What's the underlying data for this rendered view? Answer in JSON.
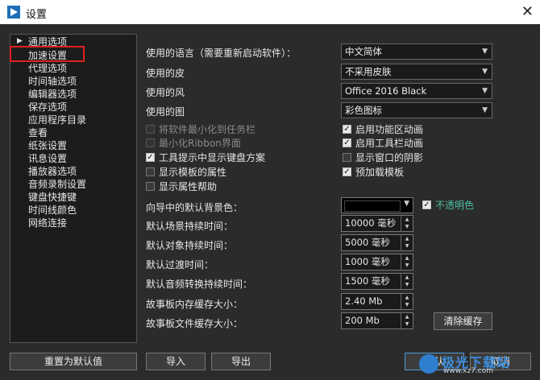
{
  "window": {
    "title": "设置"
  },
  "nav": {
    "items": [
      "通用选项",
      "加速设置",
      "代理选项",
      "时间轴选项",
      "编辑器选项",
      "保存选项",
      "应用程序目录",
      "查看",
      "纸张设置",
      "讯息设置",
      "播放器选项",
      "音频录制设置",
      "键盘快捷键",
      "时间线颜色",
      "网络连接"
    ]
  },
  "settings": {
    "language": {
      "label": "使用的语言（需要重新启动软件）：",
      "value": "中文简体"
    },
    "skin": {
      "label": "使用的皮",
      "value": "不采用皮肤"
    },
    "style": {
      "label": "使用的风",
      "value": "Office 2016 Black"
    },
    "icons": {
      "label": "使用的图",
      "value": "彩色图标"
    }
  },
  "checkboxes": {
    "left": [
      {
        "label": "将软件最小化到任务栏",
        "checked": false,
        "enabled": false
      },
      {
        "label": "最小化Ribbon界面",
        "checked": false,
        "enabled": false
      },
      {
        "label": "工具提示中显示键盘方案",
        "checked": true,
        "enabled": true
      },
      {
        "label": "显示模板的属性",
        "checked": false,
        "enabled": true
      },
      {
        "label": "显示属性帮助",
        "checked": false,
        "enabled": true
      }
    ],
    "right": [
      {
        "label": "启用功能区动画",
        "checked": true,
        "enabled": true
      },
      {
        "label": "启用工具栏动画",
        "checked": true,
        "enabled": true
      },
      {
        "label": "显示窗口的阴影",
        "checked": false,
        "enabled": true
      },
      {
        "label": "预加载模板",
        "checked": true,
        "enabled": true
      }
    ]
  },
  "wizard": {
    "bg_label": "向导中的默认背景色：",
    "bg_color": "#000000",
    "opaque_label": "不透明色",
    "opaque_checked": true
  },
  "durations": [
    {
      "label": "默认场景持续时间：",
      "value": "10000 毫秒"
    },
    {
      "label": "默认对象持续时间：",
      "value": "5000 毫秒"
    },
    {
      "label": "默认过渡时间：",
      "value": "1000 毫秒"
    },
    {
      "label": "默认音频转换持续时间：",
      "value": "1500 毫秒"
    },
    {
      "label": "故事板内存缓存大小：",
      "value": "2.40 Mb"
    },
    {
      "label": "故事板文件缓存大小：",
      "value": "200 Mb"
    }
  ],
  "buttons": {
    "clear_cache": "清除缓存",
    "reset": "重置为默认值",
    "import": "导入",
    "export": "导出",
    "ok": "确认",
    "cancel": "取消"
  },
  "watermark": {
    "text": "极光下载站",
    "url": "www.xz7.com"
  },
  "colors": {
    "highlight": "#e12020",
    "background": "#2b2b2b",
    "accent": "#4a9cd8"
  }
}
